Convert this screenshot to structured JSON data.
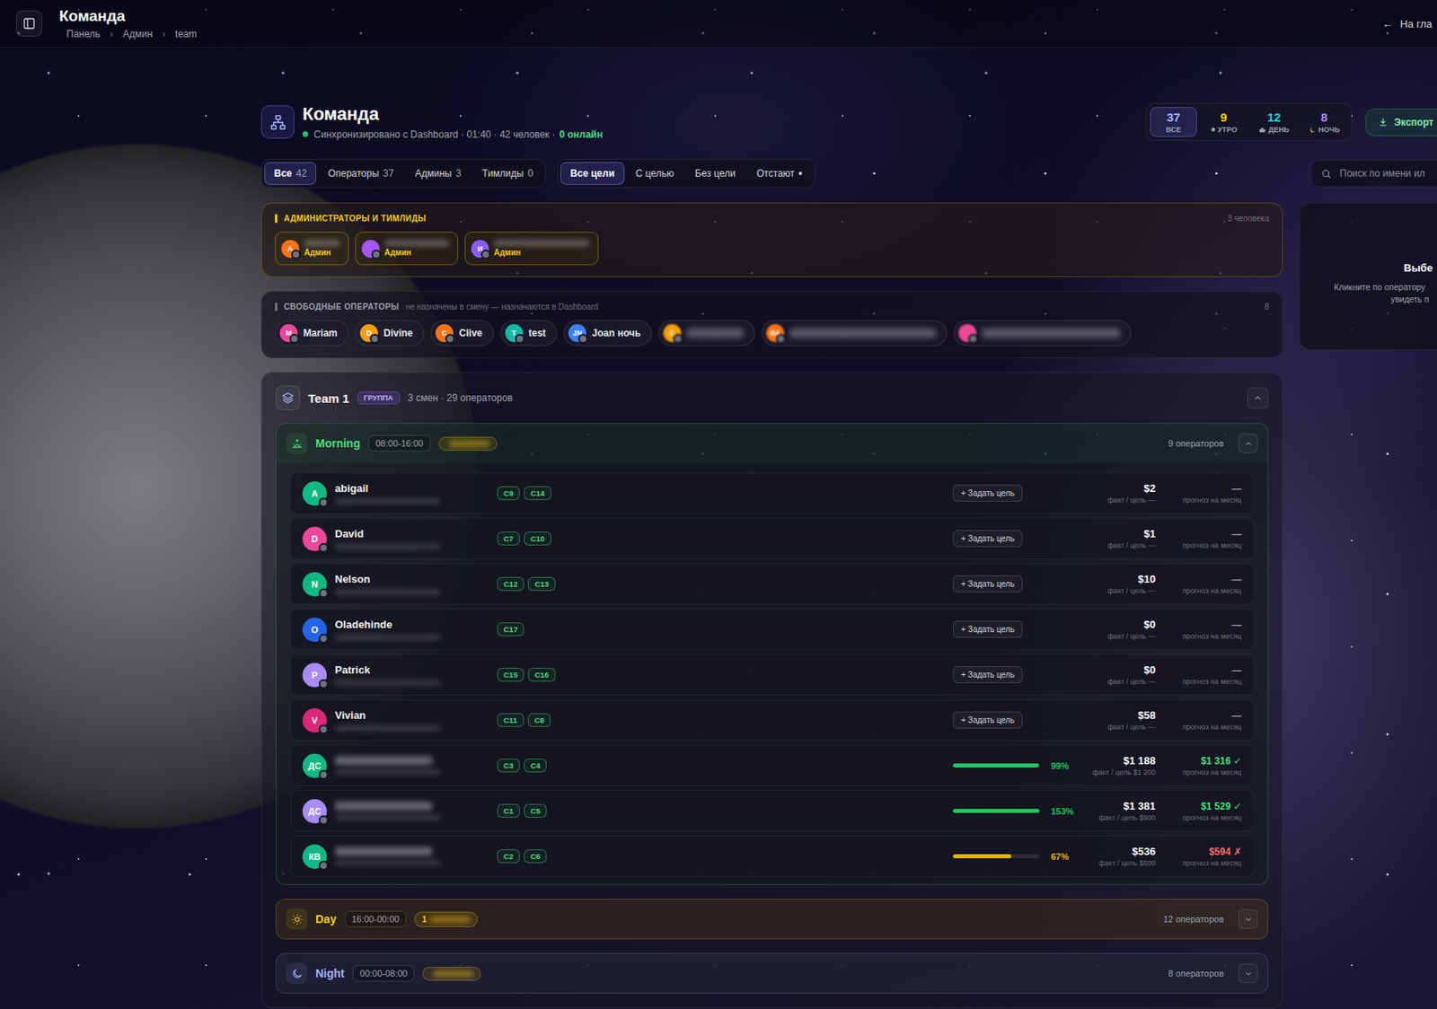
{
  "topbar": {
    "title": "Команда",
    "breadcrumbs": [
      "Панель",
      "Админ",
      "team"
    ],
    "separator": "›",
    "back_icon": "←",
    "back_label": "На гла"
  },
  "header": {
    "title": "Команда",
    "synced": true,
    "sync_text": "Синхронизировано с Dashboard · 01:40 · 42 человек ·",
    "online_text": "0 онлайн",
    "stats": [
      {
        "value": "37",
        "label": "ВСЕ",
        "kind": "all",
        "color": "#a5b4fc",
        "selected": true
      },
      {
        "value": "9",
        "label": "УТРО",
        "kind": "morning",
        "color": "#facc15",
        "selected": false
      },
      {
        "value": "12",
        "label": "ДЕНЬ",
        "kind": "day",
        "color": "#22d3ee",
        "selected": false
      },
      {
        "value": "8",
        "label": "НОЧЬ",
        "kind": "night",
        "color": "#a78bfa",
        "selected": false
      }
    ],
    "export_label": "Экспорт"
  },
  "role_tabs": [
    {
      "label": "Все",
      "count": "42",
      "selected": true
    },
    {
      "label": "Операторы",
      "count": "37",
      "selected": false
    },
    {
      "label": "Админы",
      "count": "3",
      "selected": false
    },
    {
      "label": "Тимлиды",
      "count": "0",
      "selected": false
    }
  ],
  "goal_tabs": [
    {
      "label": "Все цели",
      "selected": true,
      "dot": false
    },
    {
      "label": "С целью",
      "selected": false,
      "dot": false
    },
    {
      "label": "Без цели",
      "selected": false,
      "dot": false
    },
    {
      "label": "Отстают",
      "selected": false,
      "dot": true
    }
  ],
  "search": {
    "placeholder": "Поиск по имени ил"
  },
  "admins": {
    "title": "АДМИНИСТРАТОРЫ И ТИМЛИДЫ",
    "count": "3 человека",
    "members": [
      {
        "initial": "А",
        "role": "Админ",
        "color": "#f97316",
        "online": false
      },
      {
        "initial": "",
        "role": "Админ",
        "color": "#a855f7",
        "online": false
      },
      {
        "initial": "И",
        "role": "Админ",
        "color": "#8b5cf6",
        "online": false
      }
    ]
  },
  "free_operators": {
    "title": "СВОБОДНЫЕ ОПЕРАТОРЫ",
    "hint": "не назначены в смену — назначаются в Dashboard",
    "count": "8",
    "members": [
      {
        "initial": "M",
        "name": "Mariam",
        "color": "#ec4899",
        "online": false,
        "blurred": false
      },
      {
        "initial": "D",
        "name": "Divine",
        "color": "#f59e0b",
        "online": false,
        "blurred": false
      },
      {
        "initial": "C",
        "name": "Clive",
        "color": "#f97316",
        "online": false,
        "blurred": false
      },
      {
        "initial": "T",
        "name": "test",
        "color": "#14b8a6",
        "online": false,
        "blurred": false
      },
      {
        "initial": "JN",
        "name": "Joan ночь",
        "color": "#3b82f6",
        "online": false,
        "blurred": false
      },
      {
        "initial": "С",
        "color": "#f59e0b",
        "online": false,
        "blurred": true
      },
      {
        "initial": "ВА",
        "color": "#f97316",
        "online": false,
        "blurred": true
      },
      {
        "initial": "",
        "color": "#ec4899",
        "online": false,
        "blurred": true
      }
    ]
  },
  "team": {
    "name": "Team 1",
    "badge": "ГРУППА",
    "meta": "3 смен · 29 операторов",
    "expanded": true,
    "shifts": [
      {
        "name": "Morning",
        "time": "08:00-16:00",
        "lead_text": "",
        "count": "9 операторов",
        "kind": "morning",
        "color": "#4ade80",
        "expanded": true,
        "rows": [
          {
            "initial": "A",
            "name": "abigail",
            "blurred": false,
            "color": "#10b981",
            "online": false,
            "tags": [
              "C9",
              "C14"
            ],
            "kind": "no_goal",
            "goal_button": "+ Задать цель",
            "amount": "$2",
            "amount_note": "факт / цель —",
            "forecast": "—",
            "forecast_note": "прогноз на месяц",
            "forecast_color": "#9ca3af"
          },
          {
            "initial": "D",
            "name": "David",
            "blurred": false,
            "color": "#ec4899",
            "online": false,
            "tags": [
              "C7",
              "C10"
            ],
            "kind": "no_goal",
            "goal_button": "+ Задать цель",
            "amount": "$1",
            "amount_note": "факт / цель —",
            "forecast": "—",
            "forecast_note": "прогноз на месяц",
            "forecast_color": "#9ca3af"
          },
          {
            "initial": "N",
            "name": "Nelson",
            "blurred": false,
            "color": "#10b981",
            "online": false,
            "tags": [
              "C12",
              "C13"
            ],
            "kind": "no_goal",
            "goal_button": "+ Задать цель",
            "amount": "$10",
            "amount_note": "факт / цель —",
            "forecast": "—",
            "forecast_note": "прогноз на месяц",
            "forecast_color": "#9ca3af"
          },
          {
            "initial": "O",
            "name": "Oladehinde",
            "blurred": false,
            "color": "#2563eb",
            "online": false,
            "tags": [
              "C17"
            ],
            "kind": "no_goal",
            "goal_button": "+ Задать цель",
            "amount": "$0",
            "amount_note": "факт / цель —",
            "forecast": "—",
            "forecast_note": "прогноз на месяц",
            "forecast_color": "#9ca3af"
          },
          {
            "initial": "P",
            "name": "Patrick",
            "blurred": false,
            "color": "#a78bfa",
            "online": false,
            "tags": [
              "C15",
              "C16"
            ],
            "kind": "no_goal",
            "goal_button": "+ Задать цель",
            "amount": "$0",
            "amount_note": "факт / цель —",
            "forecast": "—",
            "forecast_note": "прогноз на месяц",
            "forecast_color": "#9ca3af"
          },
          {
            "initial": "V",
            "name": "Vivian",
            "blurred": false,
            "color": "#db2777",
            "online": false,
            "tags": [
              "C11",
              "C8"
            ],
            "kind": "no_goal",
            "goal_button": "+ Задать цель",
            "amount": "$58",
            "amount_note": "факт / цель —",
            "forecast": "—",
            "forecast_note": "прогноз на месяц",
            "forecast_color": "#9ca3af"
          },
          {
            "initial": "ДС",
            "blurred": true,
            "color": "#10b981",
            "online": false,
            "tags": [
              "C3",
              "C4"
            ],
            "kind": "goal",
            "level": 0.99,
            "percent": "99%",
            "bar_color": "#22c55e",
            "amount": "$1 188",
            "amount_note": "факт / цель $1 200",
            "forecast": "$1 316 ✓",
            "forecast_note": "прогноз на месяц",
            "forecast_color": "#4ade80"
          },
          {
            "initial": "ДС",
            "blurred": true,
            "color": "#a78bfa",
            "online": false,
            "tags": [
              "C1",
              "C5"
            ],
            "kind": "goal",
            "level": 1,
            "percent": "153%",
            "bar_color": "#22c55e",
            "amount": "$1 381",
            "amount_note": "факт / цель $900",
            "forecast": "$1 529 ✓",
            "forecast_note": "прогноз на месяц",
            "forecast_color": "#4ade80"
          },
          {
            "initial": "КВ",
            "blurred": true,
            "color": "#10b981",
            "online": false,
            "tags": [
              "C2",
              "C6"
            ],
            "kind": "goal",
            "level": 0.67,
            "percent": "67%",
            "bar_color": "#eab308",
            "amount": "$536",
            "amount_note": "факт / цель $800",
            "forecast": "$594 ✗",
            "forecast_note": "прогноз на месяц",
            "forecast_color": "#f87171"
          }
        ]
      },
      {
        "name": "Day",
        "time": "16:00-00:00",
        "lead_text": "1",
        "count": "12 операторов",
        "kind": "day",
        "color": "#facc15",
        "expanded": false,
        "rows": []
      },
      {
        "name": "Night",
        "time": "00:00-08:00",
        "lead_text": "",
        "count": "8 операторов",
        "kind": "night",
        "color": "#a5b4fc",
        "expanded": false,
        "rows": []
      }
    ]
  },
  "details_panel": {
    "title": "Выбе",
    "lines": [
      "Кликните по оператору",
      "увидеть п"
    ]
  }
}
